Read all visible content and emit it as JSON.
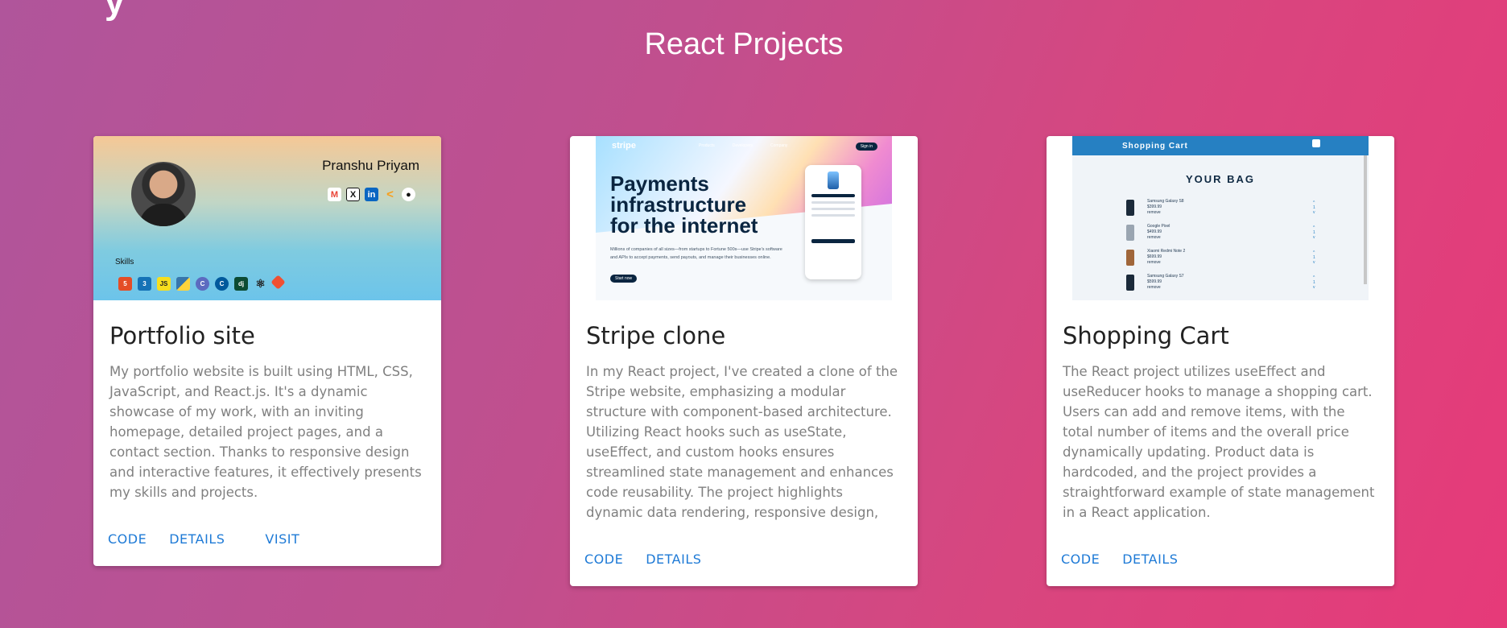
{
  "page": {
    "top_fragment": "y",
    "section_title": "React Projects"
  },
  "cards": [
    {
      "title": "Portfolio site",
      "description": "My portfolio website is built using HTML, CSS, JavaScript, and React.js. It's a dynamic showcase of my work, with an inviting homepage, detailed project pages, and a contact section. Thanks to responsive design and interactive features, it effectively presents my skills and projects.",
      "actions": [
        "CODE",
        "DETAILS",
        "VISIT"
      ],
      "preview": {
        "name": "Pranshu Priyam",
        "skills_label": "Skills",
        "social_icons": [
          "gmail-icon",
          "x-icon",
          "linkedin-icon",
          "leetcode-icon",
          "github-icon"
        ],
        "skill_icons": [
          "html5-icon",
          "css3-icon",
          "javascript-icon",
          "python-icon",
          "c-icon",
          "cplusplus-icon",
          "django-icon",
          "react-icon",
          "git-icon"
        ]
      }
    },
    {
      "title": "Stripe clone",
      "description": "In my React project, I've created a clone of the Stripe website, emphasizing a modular structure with component-based architecture. Utilizing React hooks such as useState, useEffect, and custom hooks ensures streamlined state management and enhances code reusability. The project highlights dynamic data rendering, responsive design,",
      "actions": [
        "CODE",
        "DETAILS"
      ],
      "preview": {
        "logo": "stripe",
        "nav": [
          "Products",
          "Developers",
          "Company"
        ],
        "sign_in": "Sign in",
        "headline": "Payments infrastructure for the internet",
        "subtext": "Millions of companies of all sizes—from startups to Fortune 500s—use Stripe's software and APIs to accept payments, send payouts, and manage their businesses online.",
        "cta": "Start now"
      }
    },
    {
      "title": "Shopping Cart",
      "description": "The React project utilizes useEffect and useReducer hooks to manage a shopping cart. Users can add and remove items, with the total number of items and the overall price dynamically updating. Product data is hardcoded, and the project provides a straightforward example of state management in a React application.",
      "actions": [
        "CODE",
        "DETAILS"
      ],
      "preview": {
        "nav_title": "Shopping Cart",
        "bag_title": "YOUR BAG",
        "items": [
          {
            "name": "Samsung Galaxy S8",
            "price": "$399.99",
            "qty": "1"
          },
          {
            "name": "Google Pixel",
            "price": "$499.99",
            "qty": "1"
          },
          {
            "name": "Xiaomi Redmi Note 2",
            "price": "$699.99",
            "qty": "1"
          },
          {
            "name": "Samsung Galaxy S7",
            "price": "$599.99",
            "qty": "1"
          }
        ],
        "remove_label": "remove"
      }
    }
  ]
}
